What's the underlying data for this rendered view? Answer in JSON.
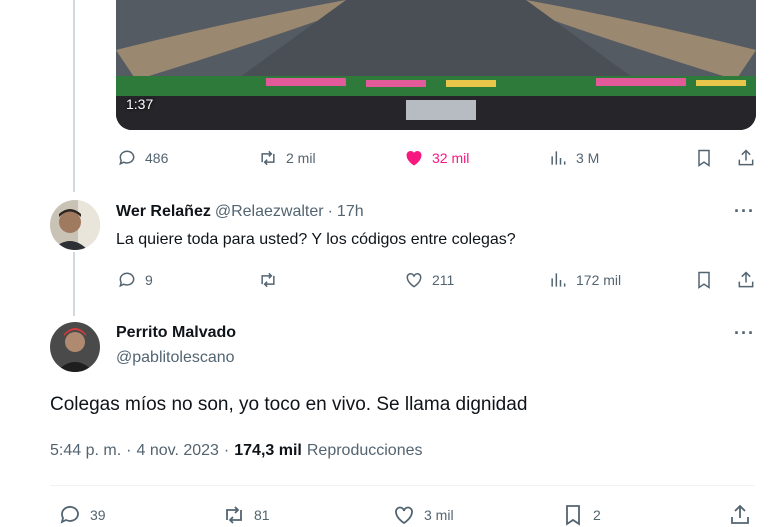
{
  "top_tweet": {
    "video": {
      "duration": "1:37"
    },
    "actions": {
      "replies": "486",
      "retweets": "2 mil",
      "likes": "32 mil",
      "views": "3 M"
    }
  },
  "reply": {
    "name": "Wer Relañez",
    "handle": "@Relaezwalter",
    "separator": "·",
    "time": "17h",
    "text": "La quiere toda para usted? Y los códigos entre colegas?",
    "actions": {
      "replies": "9",
      "retweets": "",
      "likes": "211",
      "views": "172 mil"
    }
  },
  "main_tweet": {
    "name": "Perrito Malvado",
    "handle": "@pablitolescano",
    "text": "Colegas míos no son, yo toco en vivo. Se llama dignidad",
    "time": "5:44 p. m.",
    "date": "4 nov. 2023",
    "views_count": "174,3 mil",
    "views_label": "Reproducciones",
    "actions": {
      "replies": "39",
      "retweets": "81",
      "likes": "3 mil",
      "bookmarks": "2"
    }
  },
  "more_label": "···"
}
